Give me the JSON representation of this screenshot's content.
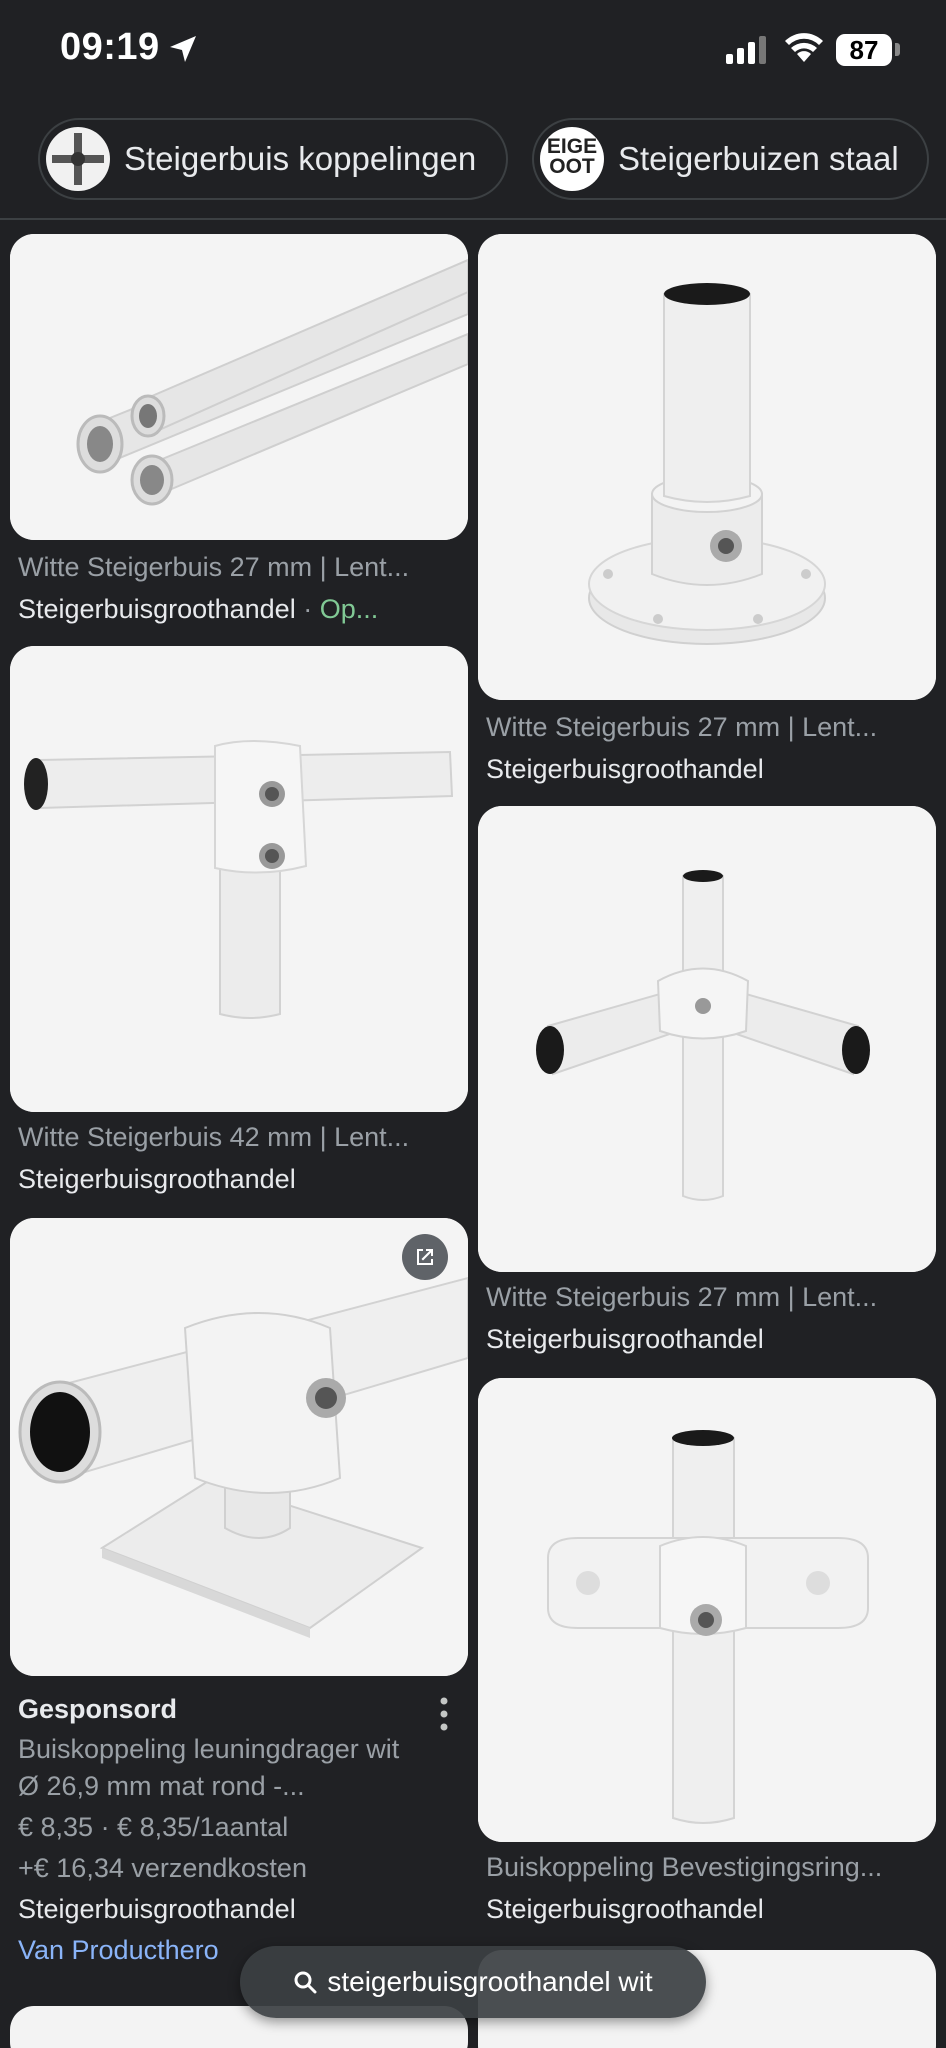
{
  "status_bar": {
    "time": "09:19",
    "battery": "87"
  },
  "chips": [
    {
      "label": "Steigerbuis koppelingen",
      "thumb_icon": "cross-coupling-icon"
    },
    {
      "label": "Steigerbuizen staal",
      "thumb_text": "EIGE OOT"
    }
  ],
  "results": {
    "left": [
      {
        "title": "Witte Steigerbuis 27 mm | Lent...",
        "source": "Steigerbuisgroothandel",
        "separator": " · ",
        "tag": "Op..."
      },
      {
        "title": "Witte Steigerbuis 42 mm | Lent...",
        "source": "Steigerbuisgroothandel"
      },
      {
        "sponsored_label": "Gesponsord",
        "title_line1": "Buiskoppeling leuningdrager wit",
        "title_line2": "Ø 26,9 mm mat rond -...",
        "price": "€ 8,35 · € 8,35/1aantal",
        "shipping": "+€ 16,34 verzendkosten",
        "source": "Steigerbuisgroothandel",
        "via": "Van Producthero"
      }
    ],
    "right": [
      {
        "title": "Witte Steigerbuis 27 mm | Lent...",
        "source": "Steigerbuisgroothandel"
      },
      {
        "title": "Witte Steigerbuis 27 mm | Lent...",
        "source": "Steigerbuisgroothandel"
      },
      {
        "title": "Buiskoppeling Bevestigingsring...",
        "source": "Steigerbuisgroothandel"
      }
    ]
  },
  "search_pill": {
    "query": "steigerbuisgroothandel wit"
  }
}
